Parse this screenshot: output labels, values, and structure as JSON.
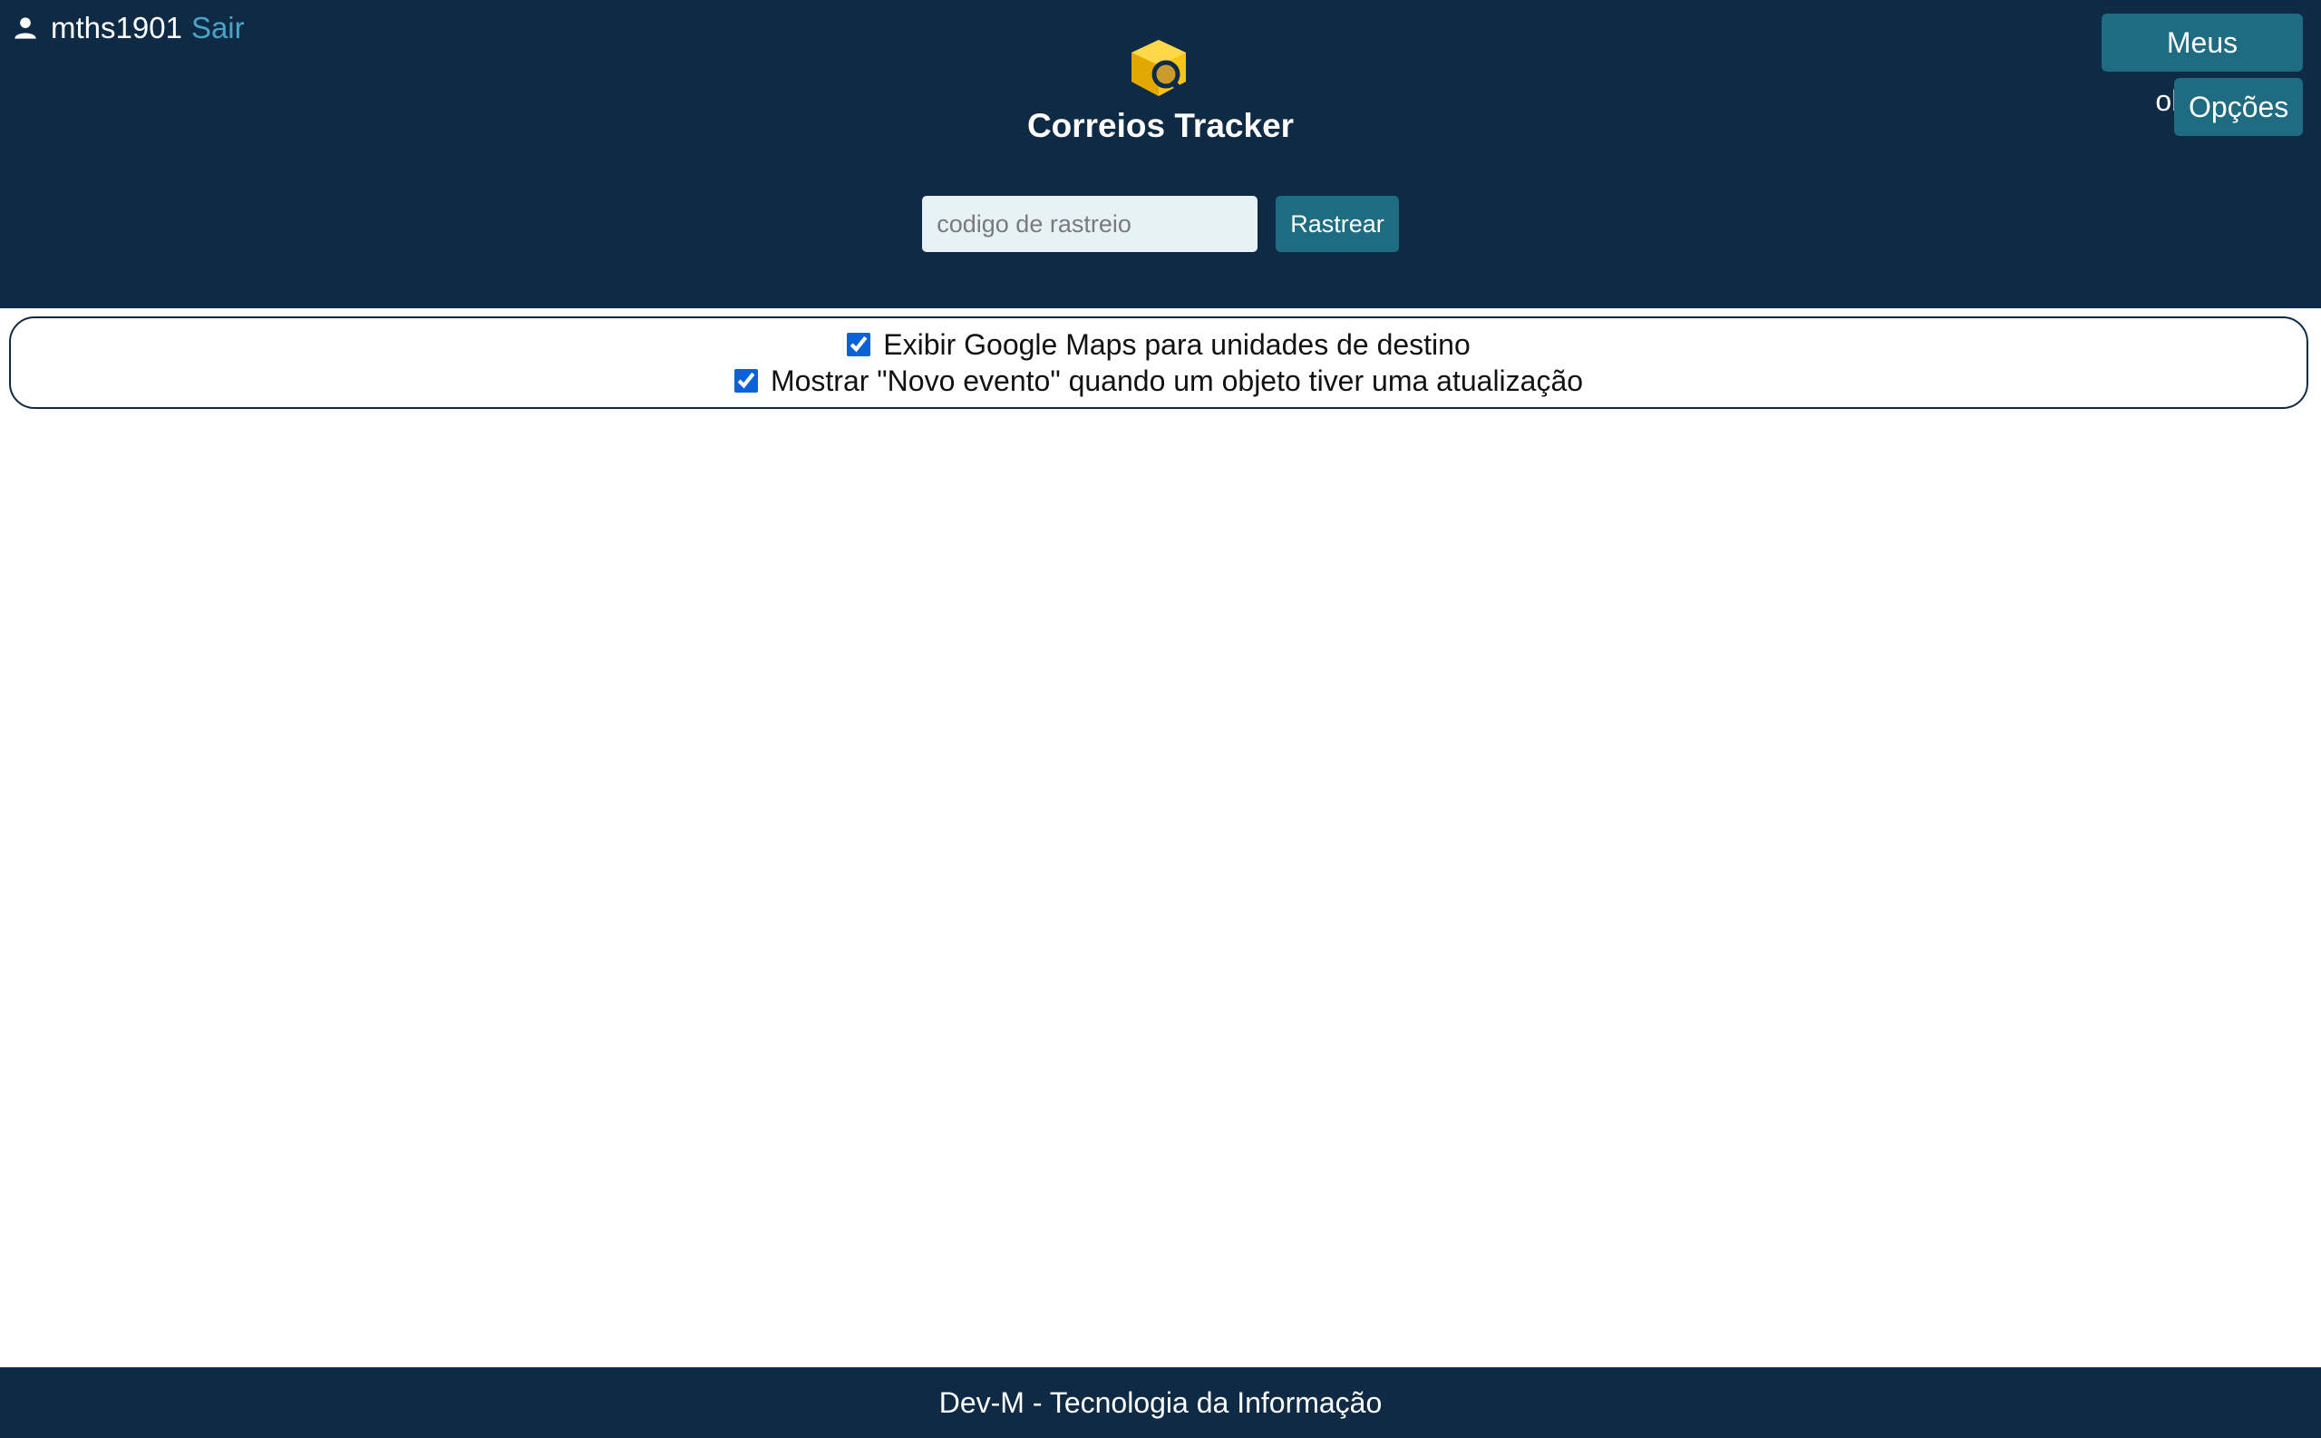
{
  "header": {
    "username": "mths1901",
    "logout_label": "Sair",
    "my_objects_label": "Meus objetos",
    "options_label": "Opções",
    "app_title": "Correios Tracker",
    "logo_icon": "box-search-icon",
    "user_icon": "user-icon"
  },
  "search": {
    "placeholder": "codigo de rastreio",
    "value": "",
    "button_label": "Rastrear"
  },
  "options": {
    "items": [
      {
        "label": "Exibir Google Maps para unidades de destino",
        "checked": true
      },
      {
        "label": "Mostrar \"Novo evento\" quando um objeto tiver uma atualização",
        "checked": true
      }
    ]
  },
  "footer": {
    "text": "Dev-M - Tecnologia da Informação"
  },
  "colors": {
    "header_bg": "#0f2a44",
    "button_bg": "#1e6b82",
    "link": "#4aa3c8",
    "logo_yellow": "#f5c518",
    "checkbox": "#0a62d8"
  }
}
